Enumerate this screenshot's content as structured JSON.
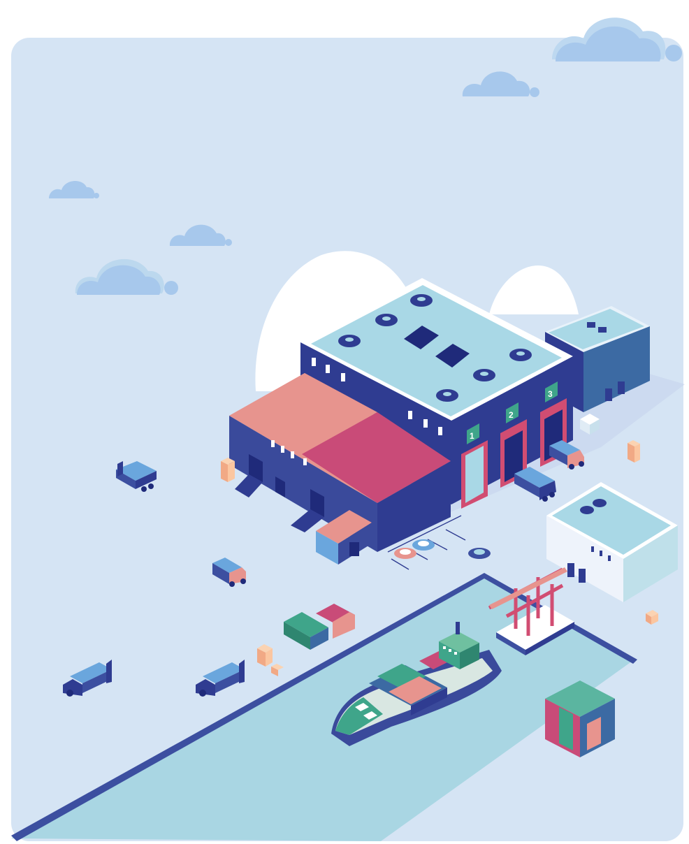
{
  "scene": {
    "kind": "isometric logistics port illustration",
    "colors": {
      "sky_panel": "#d5e4f4",
      "ground": "#d4e2f4",
      "water": "#a9d6e3",
      "quay_edge": "#3c4fa0",
      "warehouse_wall": "#2f3c91",
      "warehouse_roof": "#a9d8e6",
      "annex_roof_light": "#e7948e",
      "annex_roof_dark": "#c94b78",
      "cloud": "#a7c8ec",
      "ship_hull": "#3a4a9b",
      "ship_deck": "#d9e7e2"
    },
    "warehouse": {
      "bays": [
        {
          "number": "1"
        },
        {
          "number": "2"
        },
        {
          "number": "3"
        }
      ]
    },
    "vehicles": {
      "trucks": 7,
      "cars": 3
    },
    "icons": [
      "cloud-icon",
      "truck-icon",
      "car-icon",
      "container-icon",
      "crane-icon",
      "ship-icon",
      "box-icon"
    ]
  }
}
